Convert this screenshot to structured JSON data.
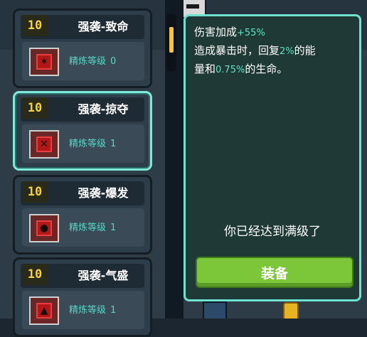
{
  "talents": [
    {
      "level": "10",
      "title": "强袭-致命",
      "refine_label": "精炼等级",
      "refine_value": "0",
      "selected": false
    },
    {
      "level": "10",
      "title": "强袭-掠夺",
      "refine_label": "精炼等级",
      "refine_value": "1",
      "selected": true
    },
    {
      "level": "10",
      "title": "强袭-爆发",
      "refine_label": "精炼等级",
      "refine_value": "1",
      "selected": false
    },
    {
      "level": "10",
      "title": "强袭-气盛",
      "refine_label": "精炼等级",
      "refine_value": "1",
      "selected": false
    }
  ],
  "detail": {
    "line1_prefix": "伤害加成",
    "line1_value": "+55",
    "line1_unit": "%",
    "line2_prefix": "造成暴击时，回复",
    "line2_value": "2",
    "line2_unit": "%",
    "line2_suffix": "的能",
    "line3_prefix": "量和",
    "line3_value": "0.75",
    "line3_unit": "%",
    "line3_suffix": "的生命。",
    "maxed_text": "你已经达到满级了",
    "equip_label": "装备"
  },
  "colors": {
    "accent": "#6fe3cf",
    "highlight": "#5be3c3",
    "level_tag": "#f3d23c",
    "equip": "#7cc63a"
  },
  "icons": {
    "chip": "red-chip-icon"
  }
}
